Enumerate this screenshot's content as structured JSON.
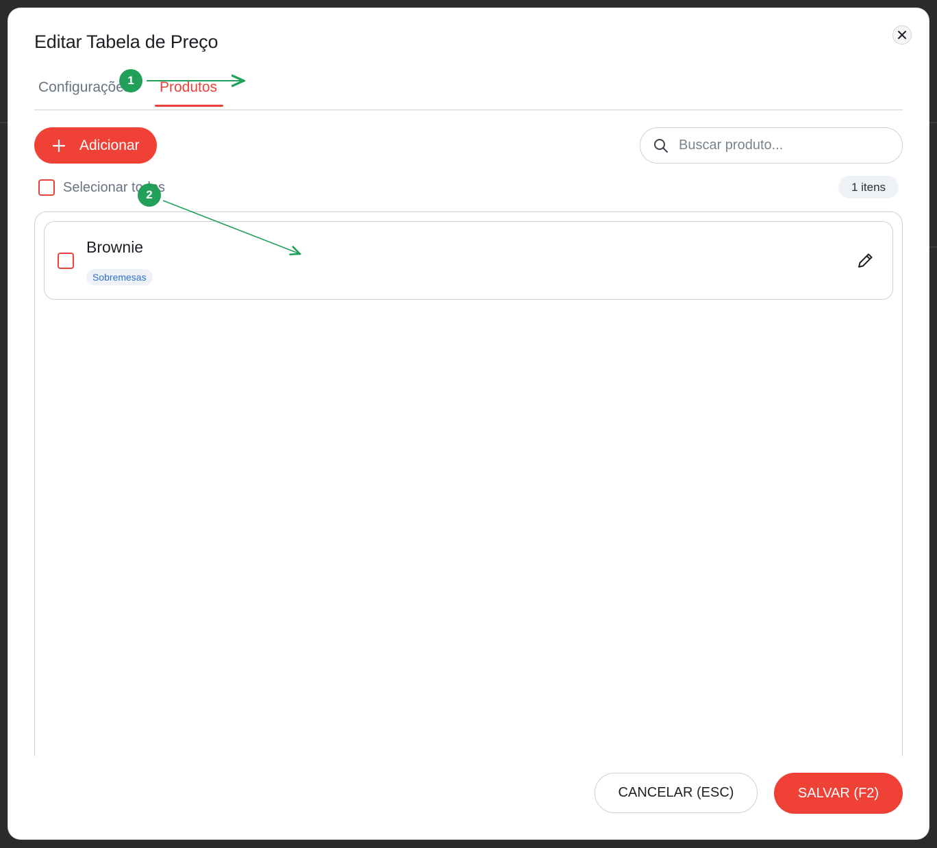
{
  "dialog": {
    "title": "Editar Tabela de Preço"
  },
  "tabs": [
    {
      "label": "Configurações",
      "active": false
    },
    {
      "label": "Produtos",
      "active": true
    }
  ],
  "toolbar": {
    "add_label": "Adicionar",
    "search_placeholder": "Buscar produto..."
  },
  "selection": {
    "select_all_label": "Selecionar todos",
    "count_label": "1 itens"
  },
  "items": [
    {
      "name": "Brownie",
      "category": "Sobremesas"
    }
  ],
  "footer": {
    "cancel_label": "CANCELAR (ESC)",
    "save_label": "SALVAR (F2)"
  },
  "annotations": [
    {
      "label": "1"
    },
    {
      "label": "2"
    }
  ],
  "colors": {
    "accent": "#ef4136",
    "annotation": "#22a05a",
    "tag_text": "#2f6fd0"
  },
  "icons": [
    "close-icon",
    "plus-icon",
    "search-icon",
    "pencil-icon"
  ]
}
